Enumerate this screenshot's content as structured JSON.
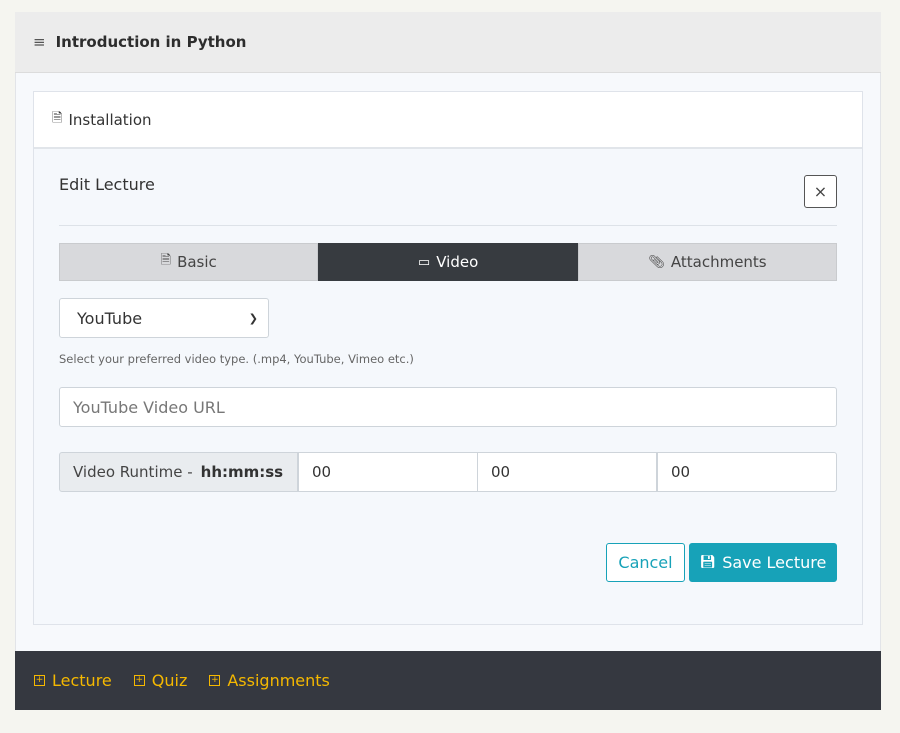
{
  "section": {
    "title": "Introduction in Python"
  },
  "lecture": {
    "title": "Installation"
  },
  "editor": {
    "title": "Edit Lecture",
    "close_label": "×",
    "tabs": [
      {
        "label": "Basic"
      },
      {
        "label": "Video"
      },
      {
        "label": "Attachments"
      }
    ],
    "active_tab": "Video",
    "video_type": {
      "value": "YouTube",
      "help": "Select your preferred video type. (.mp4, YouTube, Vimeo etc.)"
    },
    "url": {
      "placeholder": "YouTube Video URL",
      "value": ""
    },
    "runtime": {
      "label": "Video Runtime -",
      "format": "hh:mm:ss",
      "hours": "00",
      "minutes": "00",
      "seconds": "00"
    },
    "cancel_label": "Cancel",
    "save_label": "Save Lecture"
  },
  "footer": {
    "links": [
      {
        "label": "Lecture"
      },
      {
        "label": "Quiz"
      },
      {
        "label": "Assignments"
      }
    ]
  },
  "colors": {
    "accent": "#17a2b8",
    "footer_bg": "#353840",
    "footer_link": "#f5b800",
    "active_tab": "#373b40"
  }
}
